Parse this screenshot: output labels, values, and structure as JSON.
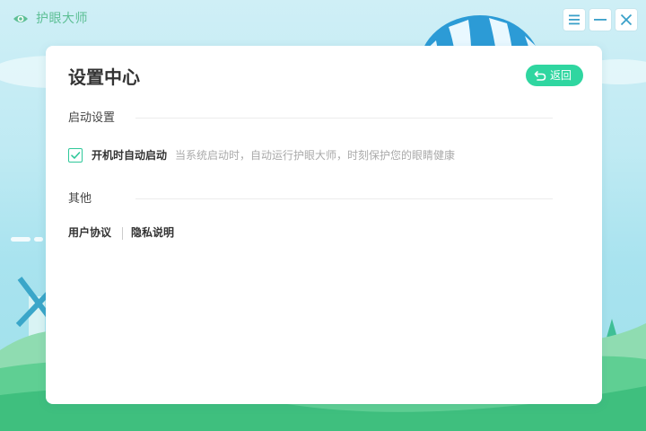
{
  "app": {
    "name": "护眼大师",
    "accent_color": "#2fd6a0"
  },
  "window_controls": {
    "menu_icon": "menu-icon",
    "minimize_icon": "minimize-icon",
    "close_icon": "close-icon"
  },
  "panel": {
    "title": "设置中心",
    "back_label": "返回",
    "back_icon": "undo-arrow-icon"
  },
  "sections": {
    "startup": {
      "title": "启动设置",
      "autostart": {
        "label": "开机时自动启动",
        "description": "当系统启动时，自动运行护眼大师，时刻保护您的眼睛健康",
        "checked": true
      }
    },
    "other": {
      "title": "其他",
      "links": {
        "user_agreement": "用户协议",
        "privacy_policy": "隐私说明"
      }
    }
  }
}
